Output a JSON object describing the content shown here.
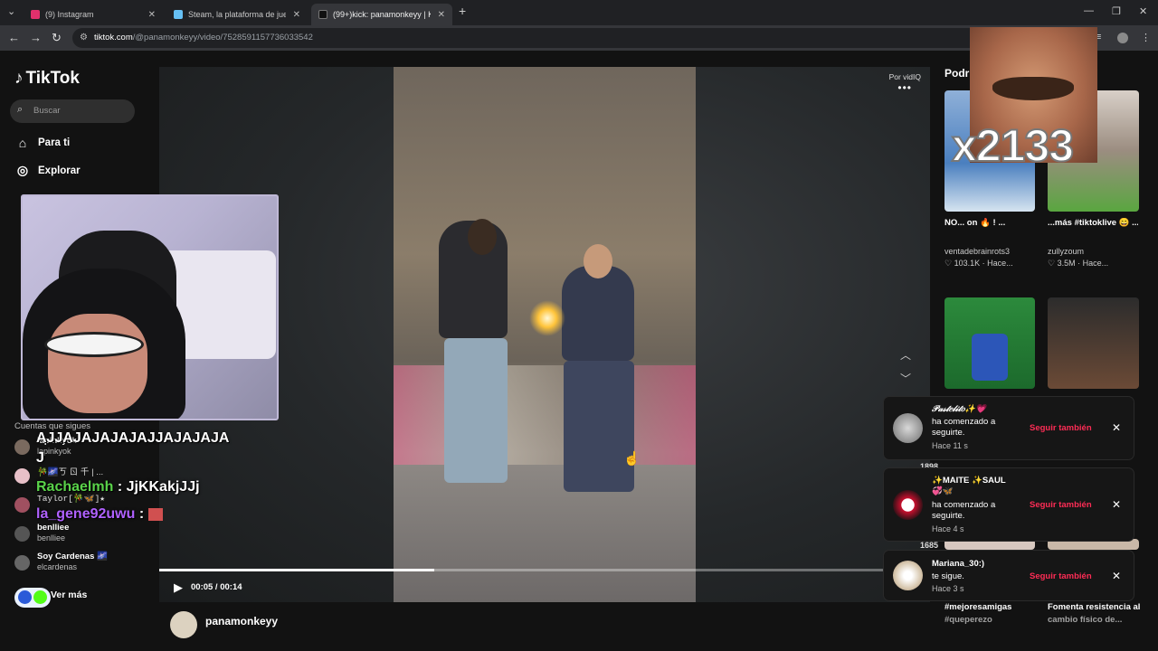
{
  "browser": {
    "tabs": [
      {
        "title": "(9) Instagram",
        "favicon_color": "#e1306c"
      },
      {
        "title": "Steam, la plataforma de juegos",
        "favicon_color": "#1b2838"
      },
      {
        "title": "(99+)kick: panamonkeyy | Kick",
        "favicon_color": "#000000"
      }
    ],
    "url_host": "tiktok.com",
    "url_path": "/@panamonkeyy/video/7528591157736033542"
  },
  "sidebar": {
    "logo": "TikTok",
    "search_placeholder": "Buscar",
    "nav": [
      {
        "label": "Para ti",
        "icon": "home-icon"
      },
      {
        "label": "Explorar",
        "icon": "compass-icon"
      }
    ],
    "following_header": "Cuentas que sigues",
    "following": [
      {
        "name": "lapinkyok",
        "handle": "lapinkyok",
        "avatar_color": "#7a6a5f"
      },
      {
        "name": "🎋🌌ㄎ ㄖ 千 | ...",
        "handle": "",
        "avatar_color": "#e8c0c8"
      },
      {
        "name": "Taylor[🎋🦋]★",
        "handle": "",
        "avatar_color": "#a05060"
      },
      {
        "name": "benlliee",
        "handle": "benlliee",
        "avatar_color": "#555555"
      },
      {
        "name": "Soy Cardenas 🌌",
        "handle": "elcardenas",
        "avatar_color": "#666666"
      }
    ],
    "see_more": "Ver más"
  },
  "player": {
    "credit": "Por vidIQ",
    "more": "•••",
    "time": "00:05 / 00:14",
    "progress": 0.357,
    "author": "panamonkeyy"
  },
  "recommended": {
    "header": "Podría interesarte",
    "cards": [
      {
        "title": "NO... on 🔥 ! ...",
        "user": "ventadebrainrots3",
        "likes": "103.1K",
        "ago": "Hace..."
      },
      {
        "title": "...más #tiktoklive 😄 ...",
        "user": "zullyzoum",
        "likes": "3.5M",
        "ago": "Hace..."
      }
    ],
    "counts": [
      "1898",
      "1685"
    ],
    "tags": [
      "#mejoresamigas",
      "#queperezo",
      "Fomenta resistencia al",
      "cambio físico de..."
    ]
  },
  "notifications": [
    {
      "user": "𝒫𝒶𝓈𝓉𝑒𝓁𝒾𝓉𝑜✨💗",
      "message": "ha comenzado a seguirte.",
      "ago": "Hace 11 s",
      "action": "Seguir también",
      "avatar_color": "#9a9a9a"
    },
    {
      "user": "✨MAITE ✨SAUL 💞🦋",
      "message": "ha comenzado a seguirte.",
      "ago": "Hace 4 s",
      "action": "Seguir también",
      "avatar_color": "#c8102e"
    },
    {
      "user": "Mariana_30:)",
      "message": "te sigue.",
      "ago": "Hace 3 s",
      "action": "Seguir también",
      "avatar_color": "#d8c8b0"
    }
  ],
  "stream_overlay": {
    "big_counter": "x2133",
    "chat": [
      {
        "user": "",
        "text": "AJJAJAJAJAJAJJAJAJAJA",
        "color": "#ffffff"
      },
      {
        "user": "",
        "text": "J",
        "color": "#ffffff"
      },
      {
        "user": "Rachaelmh",
        "text": " : JjKKakjJJj",
        "color": "#5ad34a"
      },
      {
        "user": "la_gene92uwu",
        "text": " : ",
        "color": "#b061ff"
      }
    ]
  },
  "colors": {
    "accent": "#fe2c55",
    "background": "#121212",
    "chrome": "#35363a"
  }
}
